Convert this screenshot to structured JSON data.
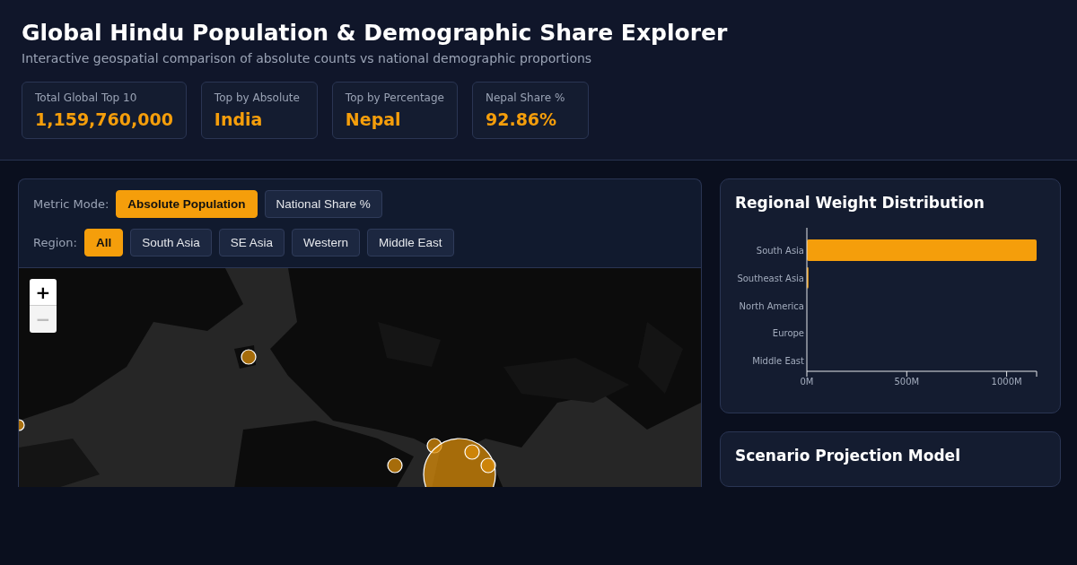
{
  "header": {
    "title": "Global Hindu Population & Demographic Share Explorer",
    "subtitle": "Interactive geospatial comparison of absolute counts vs national demographic proportions"
  },
  "stats": [
    {
      "label": "Total Global Top 10",
      "value": "1,159,760,000"
    },
    {
      "label": "Top by Absolute",
      "value": "India"
    },
    {
      "label": "Top by Percentage",
      "value": "Nepal"
    },
    {
      "label": "Nepal Share %",
      "value": "92.86%"
    }
  ],
  "controls": {
    "metric_label": "Metric Mode:",
    "metric_options": [
      {
        "label": "Absolute Population",
        "selected": true
      },
      {
        "label": "National Share %",
        "selected": false
      }
    ],
    "region_label": "Region:",
    "region_options": [
      {
        "label": "All",
        "selected": true
      },
      {
        "label": "South Asia",
        "selected": false
      },
      {
        "label": "SE Asia",
        "selected": false
      },
      {
        "label": "Western",
        "selected": false
      },
      {
        "label": "Middle East",
        "selected": false
      }
    ]
  },
  "map": {
    "kind": "picture",
    "zoom_in": "+",
    "zoom_out": "−",
    "zoom_out_disabled": true
  },
  "regional_chart": {
    "title": "Regional Weight Distribution",
    "chart_data": {
      "type": "bar",
      "orientation": "horizontal",
      "categories": [
        "South Asia",
        "Southeast Asia",
        "North America",
        "Europe",
        "Middle East"
      ],
      "series": [
        {
          "color": "#f59e0b",
          "values": [
            1150,
            8,
            null,
            null,
            null
          ]
        }
      ],
      "xlim": [
        0,
        1150
      ],
      "xticks": [
        {
          "value": 0,
          "label": "0M"
        },
        {
          "value": 500,
          "label": "500M"
        },
        {
          "value": 1000,
          "label": "1000M"
        }
      ]
    }
  },
  "scenario": {
    "title": "Scenario Projection Model"
  }
}
